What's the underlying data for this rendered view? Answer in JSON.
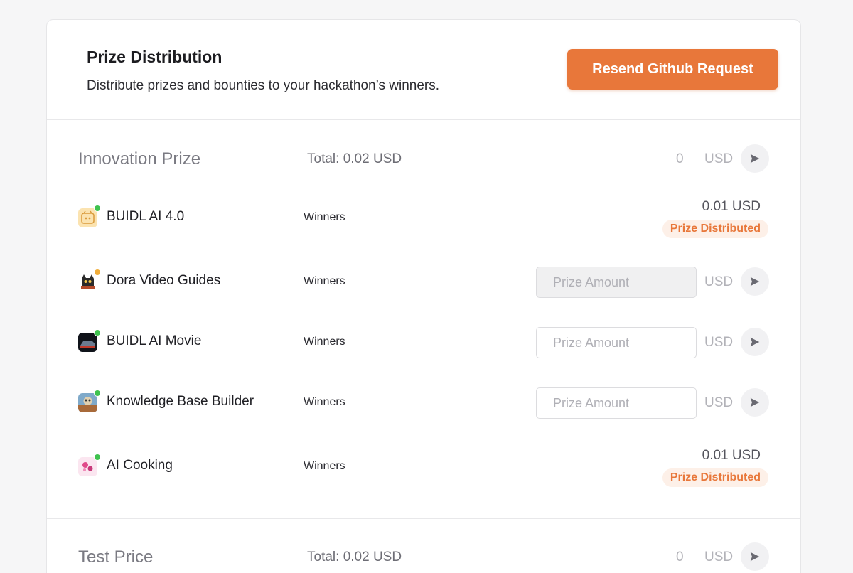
{
  "header": {
    "title": "Prize Distribution",
    "subtitle": "Distribute prizes and bounties to your hackathon’s winners.",
    "resend_label": "Resend Github Request"
  },
  "colors": {
    "accent": "#e8773a",
    "online": "#3fc24f",
    "away": "#f0ad3a"
  },
  "sections": [
    {
      "title": "Innovation Prize",
      "total": "Total: 0.02 USD",
      "amount": "0",
      "currency": "USD",
      "rows": [
        {
          "name": "BUIDL AI 4.0",
          "role": "Winners",
          "status": "distributed",
          "amount": "0.01 USD",
          "badge": "Prize Distributed",
          "dot": "online"
        },
        {
          "name": "Dora Video Guides",
          "role": "Winners",
          "status": "input",
          "placeholder": "Prize Amount",
          "currency": "USD",
          "disabled": true,
          "dot": "away"
        },
        {
          "name": "BUIDL AI Movie",
          "role": "Winners",
          "status": "input",
          "placeholder": "Prize Amount",
          "currency": "USD",
          "disabled": false,
          "dot": "online"
        },
        {
          "name": "Knowledge Base Builder",
          "role": "Winners",
          "status": "input",
          "placeholder": "Prize Amount",
          "currency": "USD",
          "disabled": false,
          "dot": "online"
        },
        {
          "name": "AI Cooking",
          "role": "Winners",
          "status": "distributed",
          "amount": "0.01 USD",
          "badge": "Prize Distributed",
          "dot": "online"
        }
      ]
    },
    {
      "title": "Test Price",
      "total": "Total: 0.02 USD",
      "amount": "0",
      "currency": "USD"
    }
  ]
}
